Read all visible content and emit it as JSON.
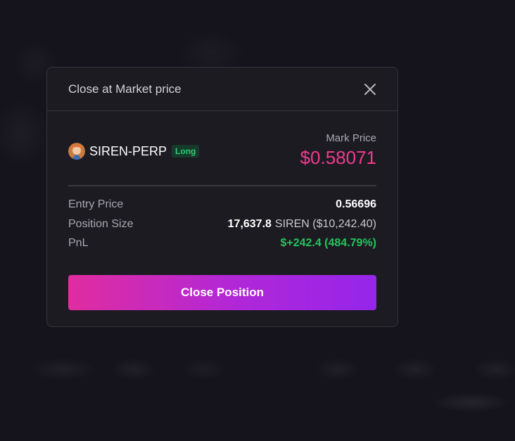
{
  "modal": {
    "title": "Close at Market price",
    "close_icon": "close-icon"
  },
  "market": {
    "symbol": "SIREN-PERP",
    "side": "Long",
    "mark_price_label": "Mark Price",
    "mark_price": "$0.58071"
  },
  "details": [
    {
      "label": "Entry Price",
      "value": "0.56696",
      "sub": ""
    },
    {
      "label": "Position Size",
      "value": "17,637.8",
      "sub": "SIREN ($10,242.40)"
    },
    {
      "label": "PnL",
      "value": "$+242.4 (484.79%)",
      "sub": ""
    }
  ],
  "action": {
    "close_position_label": "Close Position"
  },
  "colors": {
    "mark_price": "#ee3b8e",
    "pnl_positive": "#22c55e",
    "long_badge": "#2ecc71",
    "button_gradient_start": "#e02da0",
    "button_gradient_end": "#9526ea"
  }
}
